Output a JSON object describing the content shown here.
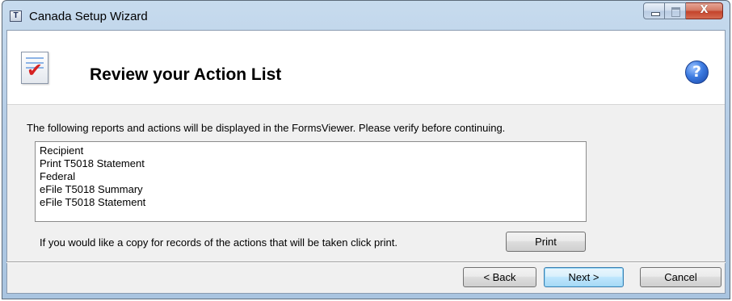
{
  "window": {
    "title": "Canada Setup Wizard",
    "app_icon_text": "T",
    "controls": {
      "minimize": "minimize",
      "maximize": "maximize",
      "close": "X"
    }
  },
  "header": {
    "title": "Review your Action List",
    "icon": "checklist-document-icon",
    "help_icon": "help-icon",
    "help_glyph": "?"
  },
  "main": {
    "instruction": "The following reports and actions will be displayed in the FormsViewer. Please verify before continuing.",
    "actions": [
      "Recipient",
      "Print T5018 Statement",
      "Federal",
      "eFile T5018 Summary",
      "eFile T5018 Statement"
    ],
    "print_note": "If you would like a copy for records of the actions that will be taken click print.",
    "print_label": "Print"
  },
  "footer": {
    "back_label": "< Back",
    "next_label": "Next >",
    "cancel_label": "Cancel"
  },
  "colors": {
    "titlebar": "#b5cde6",
    "close_button": "#c4442c",
    "default_button_border": "#3c7fb1",
    "checkmark": "#d62222",
    "help_icon": "#3b7ae0"
  }
}
